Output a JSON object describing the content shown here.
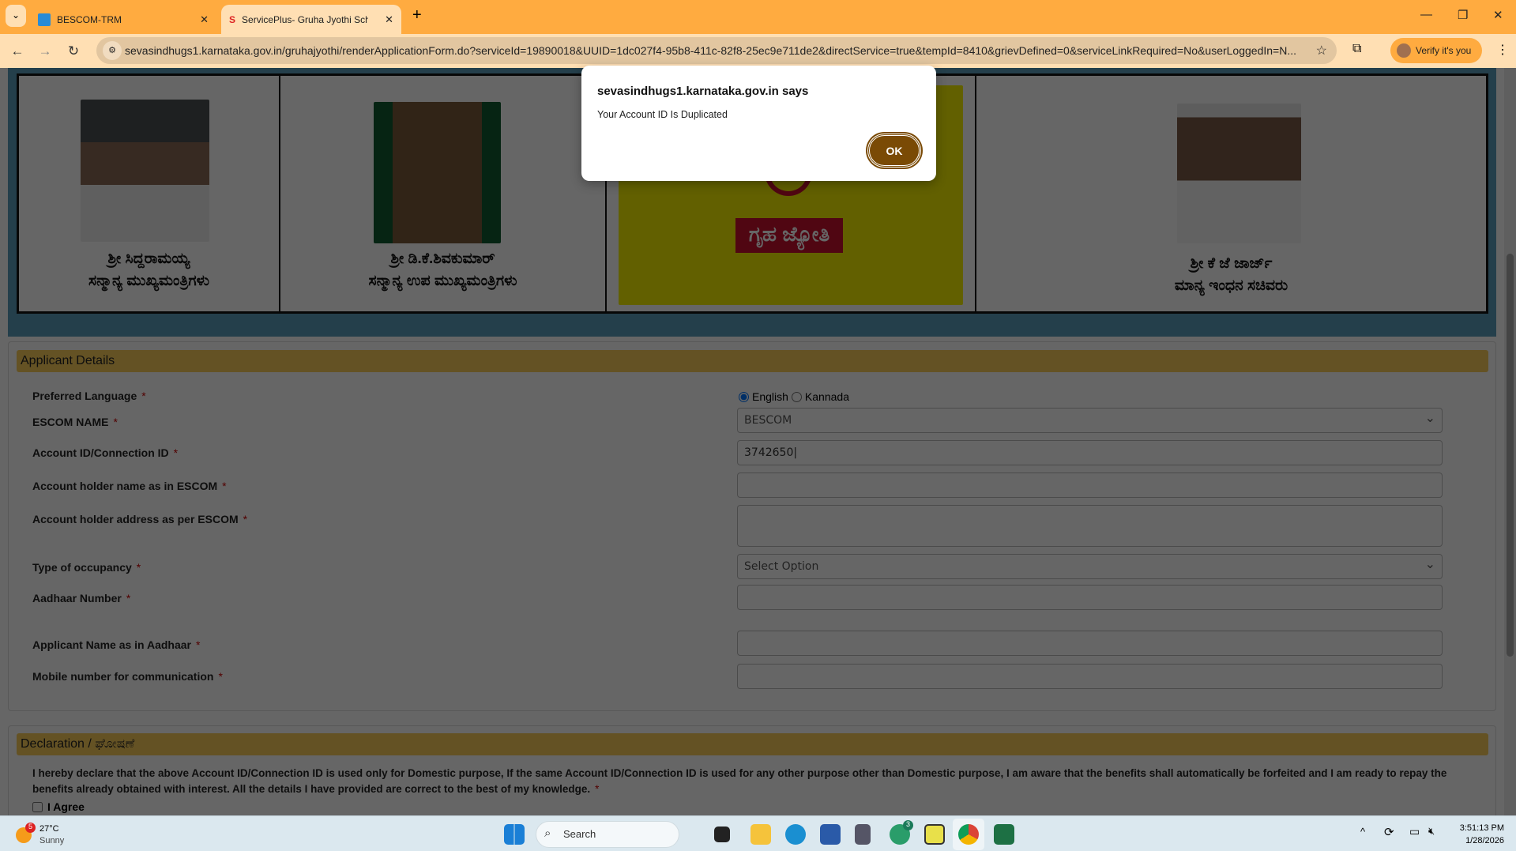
{
  "browser": {
    "tabs": [
      {
        "title": "BESCOM-TRM",
        "active": false
      },
      {
        "title": "ServicePlus- Gruha Jyothi Scheme",
        "active": true
      }
    ],
    "url": "sevasindhugs1.karnataka.gov.in/gruhajyothi/renderApplicationForm.do?serviceId=19890018&UUID=1dc027f4-95b8-411c-82f8-25ec9e711de2&directService=true&tempId=8410&grievDefined=0&serviceLinkRequired=No&userLoggedIn=N...",
    "profile_label": "Verify it's you"
  },
  "banner": {
    "people": [
      {
        "name": "ಶ್ರೀ ಸಿದ್ದರಾಮಯ್ಯ",
        "title": "ಸನ್ಮಾನ್ಯ ಮುಖ್ಯಮಂತ್ರಿಗಳು"
      },
      {
        "name": "ಶ್ರೀ ಡಿ.ಕೆ.ಶಿವಕುಮಾರ್",
        "title": "ಸನ್ಮಾನ್ಯ ಉಪ ಮುಖ್ಯಮಂತ್ರಿಗಳು"
      },
      {
        "name": "ಶ್ರೀ ಕೆ ಜೆ ಜಾರ್ಜ್",
        "title": "ಮಾನ್ಯ ಇಂಧನ ಸಚಿವರು"
      }
    ],
    "logo_text": "ಗೃಹ ಜ್ಯೋತಿ"
  },
  "applicant": {
    "heading": "Applicant Details",
    "preferred_language": {
      "label": "Preferred Language",
      "options": [
        "English",
        "Kannada"
      ],
      "selected": "English"
    },
    "escom": {
      "label": "ESCOM NAME",
      "value": "BESCOM"
    },
    "account_id": {
      "label": "Account ID/Connection ID",
      "value": "3742650"
    },
    "holder_name": {
      "label": "Account holder name as in ESCOM",
      "value": ""
    },
    "holder_address": {
      "label": "Account holder address as per ESCOM",
      "value": ""
    },
    "occupancy": {
      "label": "Type of occupancy",
      "value": "Select Option"
    },
    "aadhaar": {
      "label": "Aadhaar Number",
      "value": ""
    },
    "aadhaar_name": {
      "label": "Applicant Name as in Aadhaar",
      "value": ""
    },
    "mobile": {
      "label": "Mobile number for communication",
      "value": ""
    },
    "required_mark": "*"
  },
  "declaration": {
    "heading": "Declaration / ಘೋಷಣೆ",
    "text": "I hereby declare that the above Account ID/Connection ID is used only for Domestic purpose, If the same Account ID/Connection ID is used for any other purpose other than Domestic purpose, I am aware that the benefits shall automatically be forfeited and I am ready to repay the benefits already obtained with interest. All the details I have provided are correct to the best of my knowledge.",
    "agree_label": "I Agree"
  },
  "dialog": {
    "title": "sevasindhugs1.karnataka.gov.in says",
    "message": "Your Account ID Is Duplicated",
    "ok_label": "OK"
  },
  "taskbar": {
    "weather_temp": "27°C",
    "weather_desc": "Sunny",
    "weather_badge": "5",
    "search_placeholder": "Search",
    "whatsapp_badge": "3",
    "time": "3:51:13 PM",
    "date": "1/28/2026"
  }
}
